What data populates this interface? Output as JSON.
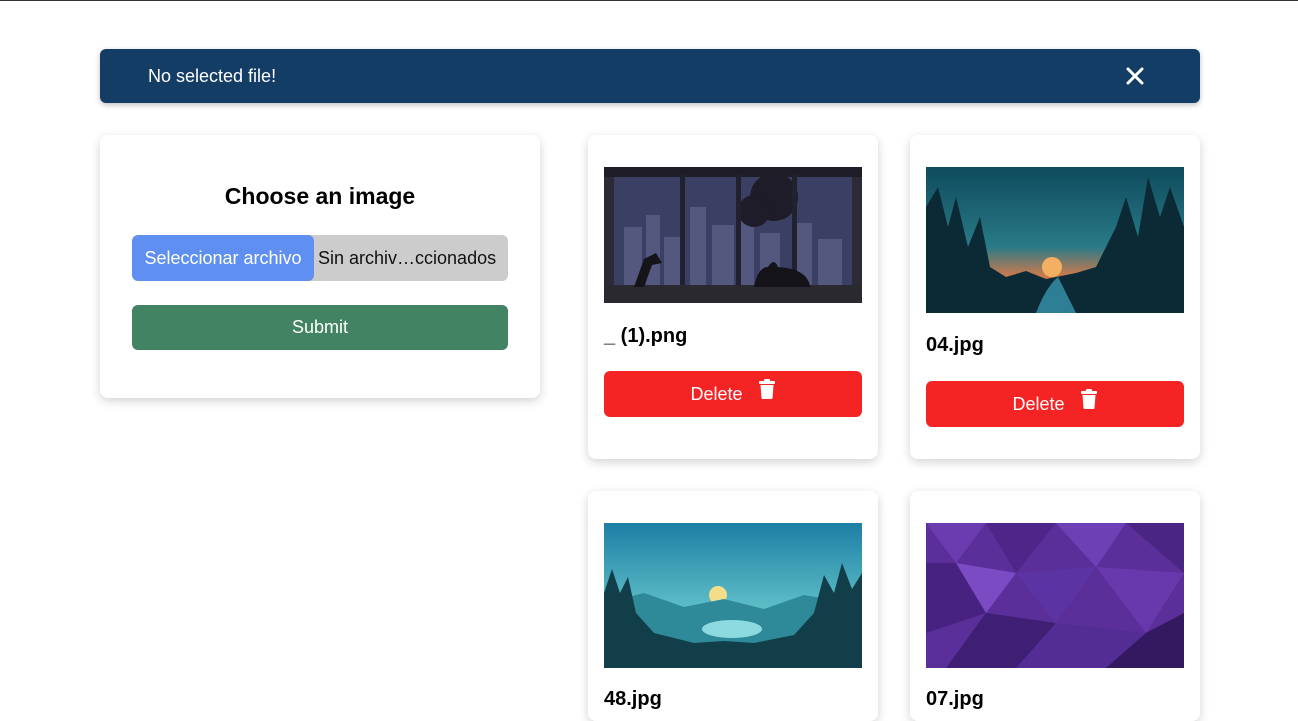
{
  "alert": {
    "message": "No selected file!",
    "close_icon": "close-icon"
  },
  "upload": {
    "title": "Choose an image",
    "file_button_label": "Seleccionar archivo",
    "file_status": "Sin archiv…ccionados",
    "submit_label": "Submit"
  },
  "gallery": {
    "delete_label": "Delete",
    "items": [
      {
        "name": "_ (1).png"
      },
      {
        "name": "04.jpg"
      },
      {
        "name": "48.jpg"
      },
      {
        "name": "07.jpg"
      }
    ]
  },
  "colors": {
    "alert_bg": "#143d66",
    "file_button": "#5f8ff0",
    "submit": "#418362",
    "delete": "#f52424"
  }
}
